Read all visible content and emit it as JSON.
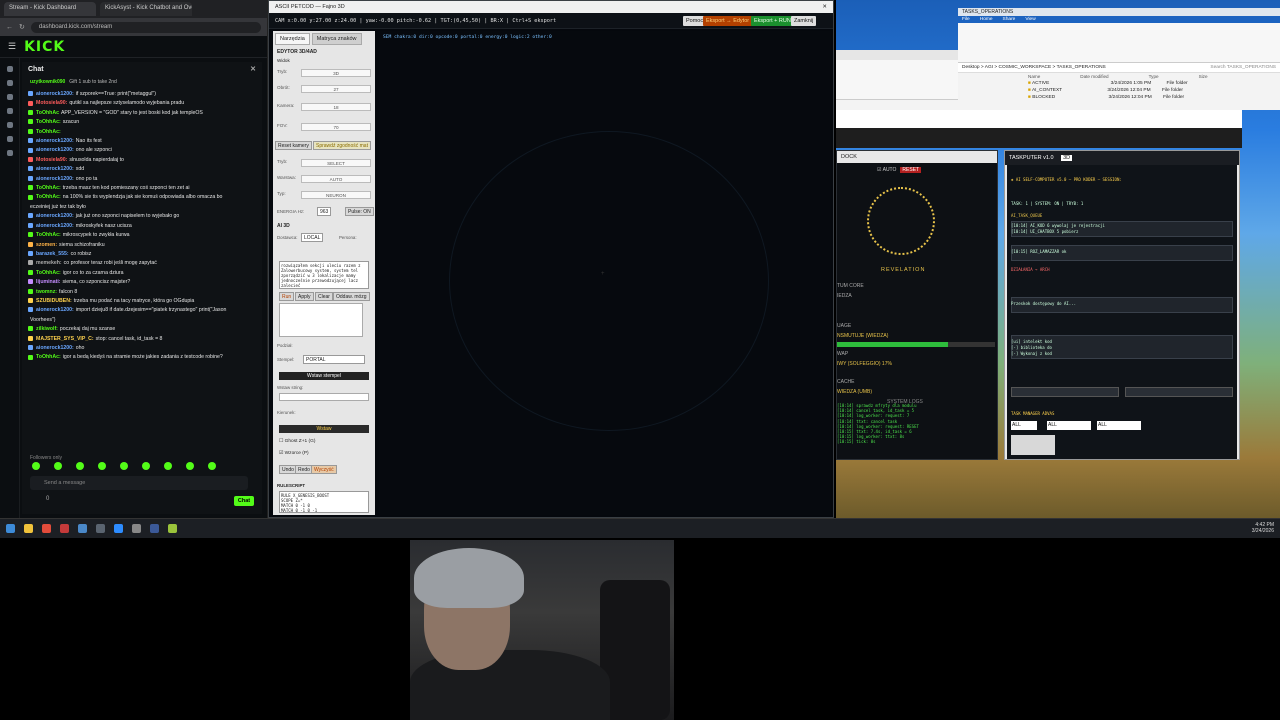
{
  "browser": {
    "tabs": [
      "Stream - Kick Dashboard",
      "KickAsyst - Kick Chatbot and Ove"
    ],
    "url": "dashboard.kick.com/stream",
    "logo": "KICK",
    "chat_title": "Chat",
    "pinned": "Gift 1 sub to take 2nd",
    "pinned_user": "uzytkownik090",
    "messages": [
      {
        "user": "aionerock1200:",
        "text": "if szporek==True: print(\"metaggul\")",
        "color": "#6aa7ff"
      },
      {
        "user": "Motosiela90:",
        "text": "qutikl sa najlepsze sztyselamodo wyjebania pradu",
        "color": "#ff5c5c"
      },
      {
        "user": "ToOhhAc",
        "text": "APP_VERSION = \"GOD\" stary to jest boski kod jak templeOS",
        "color": "#53fc18"
      },
      {
        "user": "ToOhhAc:",
        "text": "szacun",
        "color": "#53fc18"
      },
      {
        "user": "ToOhhAc:",
        "text": "",
        "color": "#53fc18"
      },
      {
        "user": "aionerock1200:",
        "text": "Nao its fest",
        "color": "#6aa7ff"
      },
      {
        "user": "aionerock1200:",
        "text": "ono ale szponci",
        "color": "#6aa7ff"
      },
      {
        "user": "Motosiela90:",
        "text": "slnusolda napierdalaj to",
        "color": "#ff5c5c"
      },
      {
        "user": "aionerock1200:",
        "text": "xdd",
        "color": "#6aa7ff"
      },
      {
        "user": "aionerock1200:",
        "text": "ono po ta",
        "color": "#6aa7ff"
      },
      {
        "user": "ToOhhAc:",
        "text": "trzeba masz ten kod pomieszany coś szponci ten zet ai",
        "color": "#53fc18"
      },
      {
        "user": "ToOhhAc:",
        "text": "na 100% sie tis wyplendzja jak sie komuś odpowiada albo omacza bo",
        "color": "#53fc18"
      },
      {
        "user": "",
        "text": "eczeiniej już tez tak było",
        "color": "#53fc18"
      },
      {
        "user": "aionerock1200:",
        "text": "jak już ono szponci napiselem to wyjebało go",
        "color": "#6aa7ff"
      },
      {
        "user": "aionerock1200:",
        "text": "mikroskyfek nasz ucisza",
        "color": "#6aa7ff"
      },
      {
        "user": "ToOhhAc:",
        "text": "mikroscypek to zwykła kurwa",
        "color": "#53fc18"
      },
      {
        "user": "szomen:",
        "text": "siema schizofraniku",
        "color": "#ffb347"
      },
      {
        "user": "barazek_555:",
        "text": "co robisz",
        "color": "#6aa7ff"
      },
      {
        "user": "memekeh:",
        "text": "co profesor teraz robi jeśli mogę zapytać",
        "color": "#aaa"
      },
      {
        "user": "ToOhhAc:",
        "text": "igor co to za czarna dziura",
        "color": "#53fc18"
      },
      {
        "user": "lijuminati:",
        "text": "siema, co szponcisz majster?",
        "color": "#c58cff"
      },
      {
        "user": "twomnz:",
        "text": "falcon 8",
        "color": "#53fc18"
      },
      {
        "user": "SZUBIDUBEN:",
        "text": "trzeba mu podać na tacy matryce, która go OGdupia",
        "color": "#ffd24d"
      },
      {
        "user": "aionerock1200:",
        "text": "import dzieju8 if date.dzejesim==\"piatek trzynastego\" print(\"Jason",
        "color": "#6aa7ff"
      },
      {
        "user": "",
        "text": "Voorhees\")",
        "color": "#6aa7ff"
      },
      {
        "user": "zilkiwolf:",
        "text": "poczekaj daj mu szanse",
        "color": "#53fc18"
      },
      {
        "user": "MAJSTER_SYS_VIP_C:",
        "text": "stop: cancel task, id_task = 8",
        "color": "#ffd24d"
      },
      {
        "user": "aionerock1200:",
        "text": "oho",
        "color": "#6aa7ff"
      },
      {
        "user": "ToOhhAc:",
        "text": "igor a bedą kiedyś na stramie może jakies zadania z testcode robine?",
        "color": "#53fc18"
      }
    ],
    "followers_only": "Followers only",
    "input_placeholder": "Send a message",
    "send_label": "Chat",
    "count": "0"
  },
  "editor": {
    "title": "ASCII PETCOD — Fajno 3D",
    "toolbar_text": "CAM x:0.00 y:27.00 z:24.00 | yaw:-0.00 pitch:-0.62 | TGT:(0,45,50) | BR:X | Ctrl+S eksport",
    "status_text": "SEM  chakra:0  dir:0  opcode:0  portal:0  energy:0  logic:2  other:0",
    "buttons": {
      "help": "Pomoc",
      "export_edytor": "Eksport → Edytor",
      "export_run": "Eksport + RUN",
      "close": "Zamknij"
    },
    "panel": {
      "tabs": [
        "Narzędzia",
        "Matryca znaków"
      ],
      "section1": "EDYTOR 3D/4AD",
      "section1b": "Widok",
      "rows": [
        {
          "label": "Tryb:",
          "value": "3D"
        },
        {
          "label": "Obrót:",
          "value": "27"
        },
        {
          "label": "Kamera:",
          "value": "18"
        },
        {
          "label": "FOV:",
          "value": "70"
        }
      ],
      "reset_camera": "Reset kamery",
      "check_consistency": "Sprawdź zgodność mat",
      "rows2": [
        {
          "label": "Tryb:",
          "value": "SELECT"
        },
        {
          "label": "Warstwa:",
          "value": "AUTO"
        },
        {
          "label": "Typ:",
          "value": "NEURON"
        }
      ],
      "energy_label": "ENERGIA Hz:",
      "energy_value": "963",
      "pulse": "Pulse: ON",
      "ai_section": "AI 3D",
      "local_label": "Dostawca:",
      "local_value": "LOCAL",
      "persona": "Persona:",
      "textbox_lines": [
        "rozwiązałem sekcji uleciu razem z",
        "Zalowerbucowy system, system tel",
        "zporządzić w 3 lokalizacje mamy",
        "jednocześnie przewodzującej lacz",
        "zalecieć"
      ],
      "ai_buttons": [
        "Run",
        "Apply",
        "Clear",
        "Oddaw. mózg"
      ],
      "podziel": "Podział:",
      "stempel": "Stempel:",
      "stempel_value": "PORTAL",
      "insert_stamp": "Wstaw stempel",
      "write_string": "Wstaw string:",
      "kierunek": "Kierunek:",
      "wstaw": "Wstaw",
      "ghost": "Ghost Z+1 (G)",
      "pattern": "Wzorce (P)",
      "undo": "Undo",
      "redo": "Redo",
      "clear": "Wyczyść",
      "rulescript": "RULESCRIPT",
      "rule_lines": [
        "RULE X_GENESIS_BOOST",
        "SCOPE Z=*",
        "MATCH 0 -1 0",
        "MATCH 0 -1 0 -1"
      ]
    }
  },
  "explorer": {
    "title": "TASKS_OPERATIONS",
    "tabs": [
      "File",
      "Home",
      "Share",
      "View"
    ],
    "path": "Desktop > AGI > COSMIC_WORKSPACE > TASKS_OPERATIONS",
    "search": "Search TASKS_OPERATIONS",
    "columns": [
      "Name",
      "Date modified",
      "Type",
      "Size"
    ],
    "rows": [
      {
        "name": "ACTIVE",
        "date": "3/24/2026 1:05 PM",
        "type": "File folder"
      },
      {
        "name": "AI_CONTEXT",
        "date": "3/24/2026 12:04 PM",
        "type": "File folder"
      },
      {
        "name": "BLOCKED",
        "date": "3/24/2026 12:04 PM",
        "type": "File folder"
      }
    ]
  },
  "dock": {
    "title": "DOCK",
    "auto": "AUTO",
    "reset": "RESET",
    "revelation": "REVELATION",
    "lines": [
      "TUM CORE",
      "IEDZA",
      "UAGE",
      "NSMUTUJE (WIEDZA)",
      "WAP",
      "IWY (SOLFEGGIO) 17%",
      "CACHE",
      "WIEDZA (UMB)"
    ],
    "system_logs": "SYSTEM LOGS",
    "progress": 0.7,
    "log_lines": [
      "[10:14] sprawdz mfryty dla modulu",
      "[10:14] cancel task, id_task = 5",
      "[10:14] log_worker: request: 7",
      "[10:14] ttxt: cancel task",
      "[10:14] log_worker: request: RESET",
      "[10:15] ttxt: 7.4s, id_task = 6",
      "[10:15] log_worker: ttxt: 8s",
      "[10:15] tick: 8s"
    ]
  },
  "taskputer": {
    "title": "TASKPUTER v1.0",
    "mode": "3D",
    "header_line": "◈ AI SELF-COMPUTER v5.0 — PRO KODER — SESSION:",
    "lines": [
      "TASK: 1 | SYSTEM: ON | TRYB: 1",
      "AI_TASK_QUEUE",
      "[10:14] AI_KOD 6 wywolaj je rejestracji",
      "[10:14] UI_CHATBOX 5 pobierz",
      "[10:15] ROZ_LAMAZZAR ok",
      "DZIAŁANIA → ARCH",
      "Przeskok dostępowy do AI...",
      "[ui] intelekt kod",
      "[-] biblioteka do",
      "[-] Wykonaj z kod"
    ],
    "filters": [
      "ALL",
      "ALL",
      "ALL"
    ],
    "task_manager": "TASK MANAGER ADVAS"
  },
  "taskbar": {
    "time": "4:42 PM",
    "date": "3/24/2026"
  }
}
